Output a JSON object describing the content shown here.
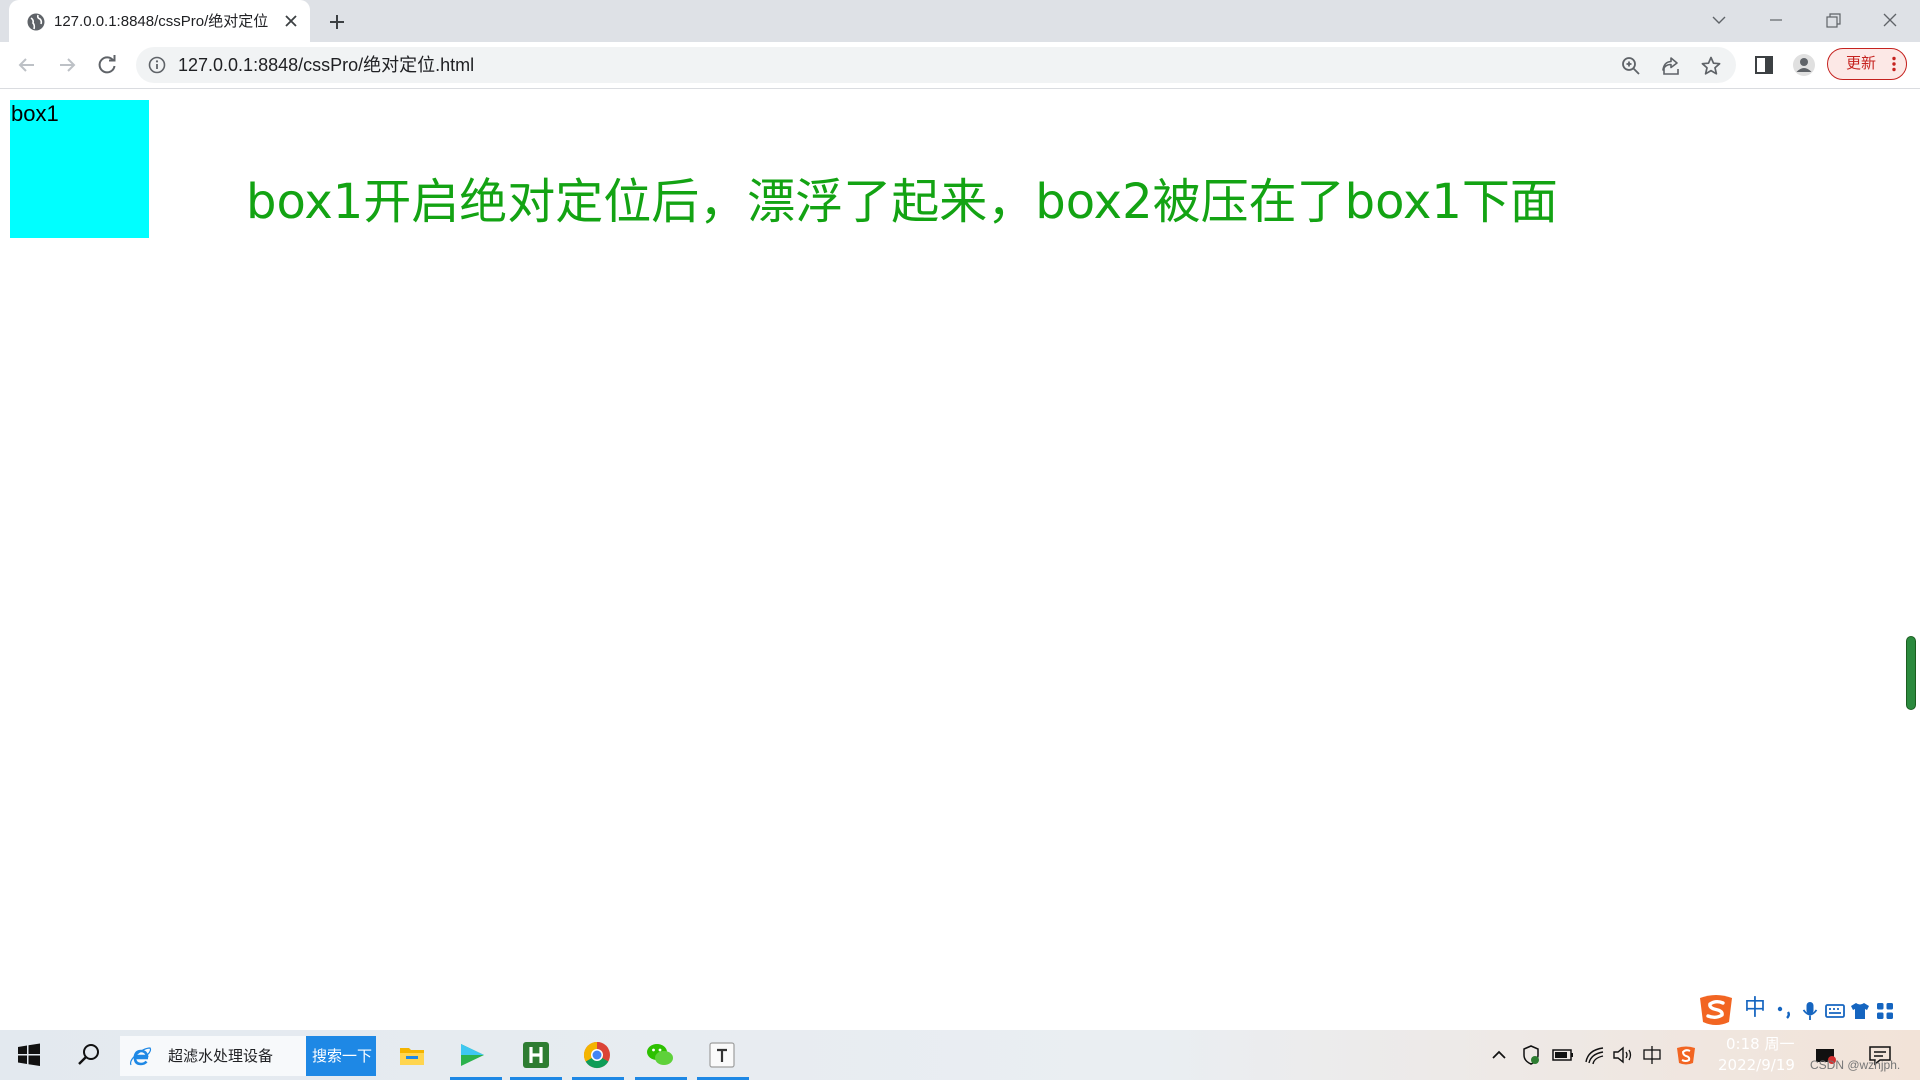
{
  "browser": {
    "tab": {
      "title": "127.0.0.1:8848/cssPro/绝对定位",
      "favicon": "globe-icon"
    },
    "new_tab_icon": "plus-icon",
    "window_controls": [
      "chevron-down-icon",
      "minimize-icon",
      "restore-icon",
      "close-icon"
    ]
  },
  "toolbar": {
    "nav_icons": [
      "back-arrow-icon",
      "forward-arrow-icon",
      "reload-icon"
    ],
    "url": "127.0.0.1:8848/cssPro/绝对定位.html",
    "omnibox_icons": [
      "zoom-icon",
      "share-icon",
      "star-icon"
    ],
    "side_panel_icon": "side-panel-icon",
    "profile_icon": "profile-icon",
    "update_label": "更新",
    "update_color": "#c5221f"
  },
  "page": {
    "box1_label": "box1",
    "box1_color": "#00ffff",
    "message": "box1开启绝对定位后，漂浮了起来，box2被压在了box1下面",
    "message_color": "#13a313"
  },
  "ime": {
    "logo": "sogou-s-icon",
    "lang": "中",
    "icons": [
      "punctuation-icon",
      "microphone-icon",
      "keyboard-icon",
      "skin-shirt-icon",
      "grid-icon"
    ]
  },
  "taskbar": {
    "search_text": "超滤水处理设备",
    "search_button": "搜索一下",
    "apps": [
      "file-explorer-icon",
      "media-player-icon",
      "hbuilder-icon",
      "chrome-icon",
      "wechat-icon",
      "typora-icon"
    ],
    "tray_icons": [
      "tray-chevron-icon",
      "security-icon",
      "battery-icon",
      "wifi-icon",
      "volume-icon",
      "ime-icon",
      "sogou-icon"
    ],
    "time": "0:18 周一",
    "date": "2022/9/19",
    "watermark": "CSDN @wzhjph.",
    "accent": "#1e88e5"
  }
}
